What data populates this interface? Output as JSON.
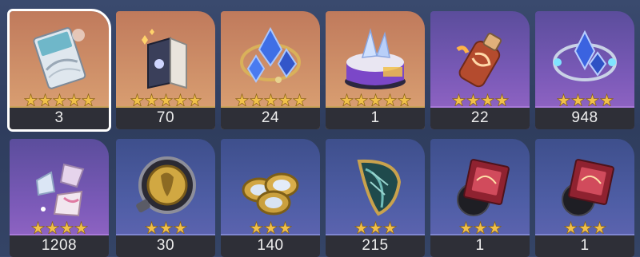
{
  "inventory": {
    "items": [
      {
        "icon": "ticket-pass-icon",
        "count": "3",
        "stars": 5,
        "rarity": "r5",
        "selected": true
      },
      {
        "icon": "book-icon",
        "count": "70",
        "stars": 5,
        "rarity": "r5"
      },
      {
        "icon": "crystal-cluster-icon",
        "count": "24",
        "stars": 5,
        "rarity": "r5"
      },
      {
        "icon": "cake-icon",
        "count": "1",
        "stars": 5,
        "rarity": "r5"
      },
      {
        "icon": "potion-bottle-icon",
        "count": "22",
        "stars": 4,
        "rarity": "r4"
      },
      {
        "icon": "crystal-ring-icon",
        "count": "948",
        "stars": 4,
        "rarity": "r4"
      },
      {
        "icon": "shards-icon",
        "count": "1208",
        "stars": 4,
        "rarity": "r4"
      },
      {
        "icon": "medallion-icon",
        "count": "30",
        "stars": 3,
        "rarity": "r3"
      },
      {
        "icon": "coins-icon",
        "count": "140",
        "stars": 3,
        "rarity": "r3"
      },
      {
        "icon": "leaf-emblem-icon",
        "count": "215",
        "stars": 3,
        "rarity": "r3"
      },
      {
        "icon": "record-box-icon",
        "count": "1",
        "stars": 3,
        "rarity": "r3"
      },
      {
        "icon": "record-box-icon",
        "count": "1",
        "stars": 3,
        "rarity": "r3"
      }
    ]
  },
  "colors": {
    "rarity5": "#d0926a",
    "rarity4": "#7b5ab8",
    "rarity3": "#4f5ea6",
    "star": "#f1c04a",
    "count_bar": "#2e2f37"
  }
}
